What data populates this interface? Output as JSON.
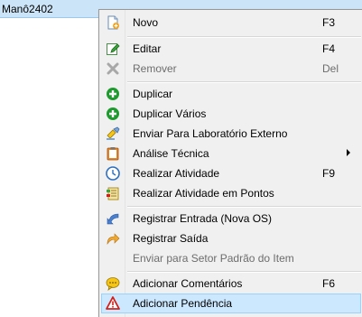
{
  "background": {
    "row_text": "Manô2402",
    "row_color": "#cce4f7"
  },
  "menu": {
    "items": [
      {
        "label": "Novo",
        "shortcut": "F3",
        "icon": "new-document-icon"
      },
      {
        "label": "Editar",
        "shortcut": "F4",
        "icon": "edit-icon"
      },
      {
        "label": "Remover",
        "shortcut": "Del",
        "icon": "remove-icon",
        "disabled": true
      },
      {
        "label": "Duplicar",
        "shortcut": "",
        "icon": "duplicate-icon"
      },
      {
        "label": "Duplicar Vários",
        "shortcut": "",
        "icon": "duplicate-multiple-icon"
      },
      {
        "label": "Enviar Para Laboratório Externo",
        "shortcut": "",
        "icon": "send-lab-icon"
      },
      {
        "label": "Análise Técnica",
        "shortcut": "",
        "icon": "clipboard-icon",
        "submenu": true
      },
      {
        "label": "Realizar Atividade",
        "shortcut": "F9",
        "icon": "clock-icon"
      },
      {
        "label": "Realizar Atividade em Pontos",
        "shortcut": "",
        "icon": "activity-points-icon"
      },
      {
        "label": "Registrar Entrada (Nova OS)",
        "shortcut": "",
        "icon": "entry-arrow-icon"
      },
      {
        "label": "Registrar Saída",
        "shortcut": "",
        "icon": "exit-arrow-icon"
      },
      {
        "label": "Enviar para Setor Padrão do Item",
        "shortcut": "",
        "icon": "",
        "disabled": true
      },
      {
        "label": "Adicionar Comentários",
        "shortcut": "F6",
        "icon": "comment-icon"
      },
      {
        "label": "Adicionar Pendência",
        "shortcut": "",
        "icon": "warning-icon",
        "highlighted": true
      }
    ]
  },
  "colors": {
    "accent": "#cce8ff",
    "accent_border": "#99d1ff",
    "green": "#1e9b2e",
    "red": "#d0201c"
  }
}
